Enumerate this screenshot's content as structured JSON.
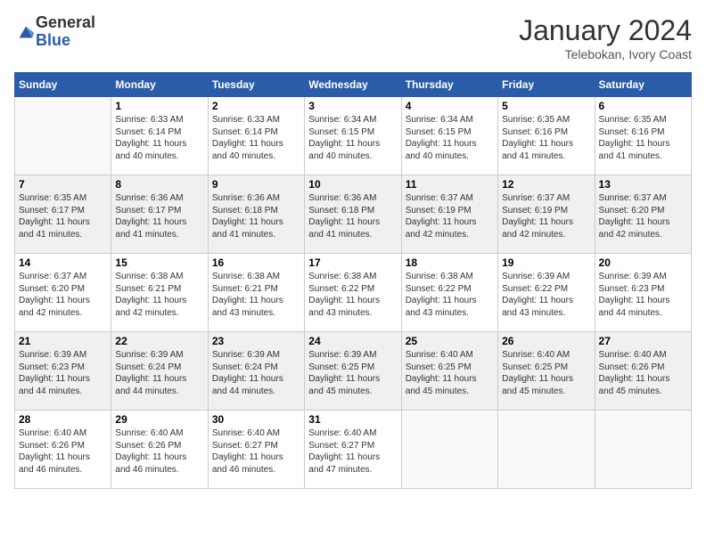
{
  "logo": {
    "general": "General",
    "blue": "Blue"
  },
  "header": {
    "month": "January 2024",
    "location": "Telebokan, Ivory Coast"
  },
  "weekdays": [
    "Sunday",
    "Monday",
    "Tuesday",
    "Wednesday",
    "Thursday",
    "Friday",
    "Saturday"
  ],
  "weeks": [
    [
      {
        "day": "",
        "info": ""
      },
      {
        "day": "1",
        "info": "Sunrise: 6:33 AM\nSunset: 6:14 PM\nDaylight: 11 hours\nand 40 minutes."
      },
      {
        "day": "2",
        "info": "Sunrise: 6:33 AM\nSunset: 6:14 PM\nDaylight: 11 hours\nand 40 minutes."
      },
      {
        "day": "3",
        "info": "Sunrise: 6:34 AM\nSunset: 6:15 PM\nDaylight: 11 hours\nand 40 minutes."
      },
      {
        "day": "4",
        "info": "Sunrise: 6:34 AM\nSunset: 6:15 PM\nDaylight: 11 hours\nand 40 minutes."
      },
      {
        "day": "5",
        "info": "Sunrise: 6:35 AM\nSunset: 6:16 PM\nDaylight: 11 hours\nand 41 minutes."
      },
      {
        "day": "6",
        "info": "Sunrise: 6:35 AM\nSunset: 6:16 PM\nDaylight: 11 hours\nand 41 minutes."
      }
    ],
    [
      {
        "day": "7",
        "info": "Sunrise: 6:35 AM\nSunset: 6:17 PM\nDaylight: 11 hours\nand 41 minutes."
      },
      {
        "day": "8",
        "info": "Sunrise: 6:36 AM\nSunset: 6:17 PM\nDaylight: 11 hours\nand 41 minutes."
      },
      {
        "day": "9",
        "info": "Sunrise: 6:36 AM\nSunset: 6:18 PM\nDaylight: 11 hours\nand 41 minutes."
      },
      {
        "day": "10",
        "info": "Sunrise: 6:36 AM\nSunset: 6:18 PM\nDaylight: 11 hours\nand 41 minutes."
      },
      {
        "day": "11",
        "info": "Sunrise: 6:37 AM\nSunset: 6:19 PM\nDaylight: 11 hours\nand 42 minutes."
      },
      {
        "day": "12",
        "info": "Sunrise: 6:37 AM\nSunset: 6:19 PM\nDaylight: 11 hours\nand 42 minutes."
      },
      {
        "day": "13",
        "info": "Sunrise: 6:37 AM\nSunset: 6:20 PM\nDaylight: 11 hours\nand 42 minutes."
      }
    ],
    [
      {
        "day": "14",
        "info": "Sunrise: 6:37 AM\nSunset: 6:20 PM\nDaylight: 11 hours\nand 42 minutes."
      },
      {
        "day": "15",
        "info": "Sunrise: 6:38 AM\nSunset: 6:21 PM\nDaylight: 11 hours\nand 42 minutes."
      },
      {
        "day": "16",
        "info": "Sunrise: 6:38 AM\nSunset: 6:21 PM\nDaylight: 11 hours\nand 43 minutes."
      },
      {
        "day": "17",
        "info": "Sunrise: 6:38 AM\nSunset: 6:22 PM\nDaylight: 11 hours\nand 43 minutes."
      },
      {
        "day": "18",
        "info": "Sunrise: 6:38 AM\nSunset: 6:22 PM\nDaylight: 11 hours\nand 43 minutes."
      },
      {
        "day": "19",
        "info": "Sunrise: 6:39 AM\nSunset: 6:22 PM\nDaylight: 11 hours\nand 43 minutes."
      },
      {
        "day": "20",
        "info": "Sunrise: 6:39 AM\nSunset: 6:23 PM\nDaylight: 11 hours\nand 44 minutes."
      }
    ],
    [
      {
        "day": "21",
        "info": "Sunrise: 6:39 AM\nSunset: 6:23 PM\nDaylight: 11 hours\nand 44 minutes."
      },
      {
        "day": "22",
        "info": "Sunrise: 6:39 AM\nSunset: 6:24 PM\nDaylight: 11 hours\nand 44 minutes."
      },
      {
        "day": "23",
        "info": "Sunrise: 6:39 AM\nSunset: 6:24 PM\nDaylight: 11 hours\nand 44 minutes."
      },
      {
        "day": "24",
        "info": "Sunrise: 6:39 AM\nSunset: 6:25 PM\nDaylight: 11 hours\nand 45 minutes."
      },
      {
        "day": "25",
        "info": "Sunrise: 6:40 AM\nSunset: 6:25 PM\nDaylight: 11 hours\nand 45 minutes."
      },
      {
        "day": "26",
        "info": "Sunrise: 6:40 AM\nSunset: 6:25 PM\nDaylight: 11 hours\nand 45 minutes."
      },
      {
        "day": "27",
        "info": "Sunrise: 6:40 AM\nSunset: 6:26 PM\nDaylight: 11 hours\nand 45 minutes."
      }
    ],
    [
      {
        "day": "28",
        "info": "Sunrise: 6:40 AM\nSunset: 6:26 PM\nDaylight: 11 hours\nand 46 minutes."
      },
      {
        "day": "29",
        "info": "Sunrise: 6:40 AM\nSunset: 6:26 PM\nDaylight: 11 hours\nand 46 minutes."
      },
      {
        "day": "30",
        "info": "Sunrise: 6:40 AM\nSunset: 6:27 PM\nDaylight: 11 hours\nand 46 minutes."
      },
      {
        "day": "31",
        "info": "Sunrise: 6:40 AM\nSunset: 6:27 PM\nDaylight: 11 hours\nand 47 minutes."
      },
      {
        "day": "",
        "info": ""
      },
      {
        "day": "",
        "info": ""
      },
      {
        "day": "",
        "info": ""
      }
    ]
  ]
}
